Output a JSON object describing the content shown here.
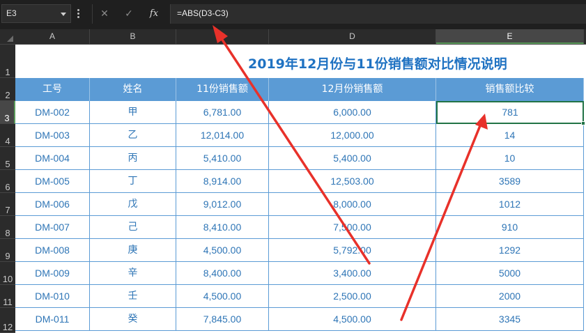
{
  "formula_bar": {
    "cell_ref": "E3",
    "cancel_icon": "✕",
    "enter_icon": "✓",
    "fx_label": "fx",
    "formula": "=ABS(D3-C3)"
  },
  "columns": [
    "A",
    "B",
    "C",
    "D",
    "E"
  ],
  "row_numbers": [
    "1",
    "2",
    "3",
    "4",
    "5",
    "6",
    "7",
    "8",
    "9",
    "10",
    "11",
    "12"
  ],
  "sheet": {
    "title": "2019年12月份与11份销售额对比情况说明",
    "headers": [
      "工号",
      "姓名",
      "11份销售额",
      "12月份销售额",
      "销售额比较"
    ],
    "rows": [
      [
        "DM-002",
        "甲",
        "6,781.00",
        "6,000.00",
        "781"
      ],
      [
        "DM-003",
        "乙",
        "12,014.00",
        "12,000.00",
        "14"
      ],
      [
        "DM-004",
        "丙",
        "5,410.00",
        "5,400.00",
        "10"
      ],
      [
        "DM-005",
        "丁",
        "8,914.00",
        "12,503.00",
        "3589"
      ],
      [
        "DM-006",
        "戊",
        "9,012.00",
        "8,000.00",
        "1012"
      ],
      [
        "DM-007",
        "己",
        "8,410.00",
        "7,500.00",
        "910"
      ],
      [
        "DM-008",
        "庚",
        "4,500.00",
        "5,792.00",
        "1292"
      ],
      [
        "DM-009",
        "辛",
        "8,400.00",
        "3,400.00",
        "5000"
      ],
      [
        "DM-010",
        "壬",
        "4,500.00",
        "2,500.00",
        "2000"
      ],
      [
        "DM-011",
        "癸",
        "7,845.00",
        "4,500.00",
        "3345"
      ]
    ]
  },
  "selection": {
    "column": "E",
    "row": "3"
  },
  "colors": {
    "header_fill": "#5b9bd5",
    "title_text": "#1f72c2",
    "cell_text": "#2e75b6",
    "annotation_arrow": "#e8312a",
    "selection_border": "#217346"
  }
}
